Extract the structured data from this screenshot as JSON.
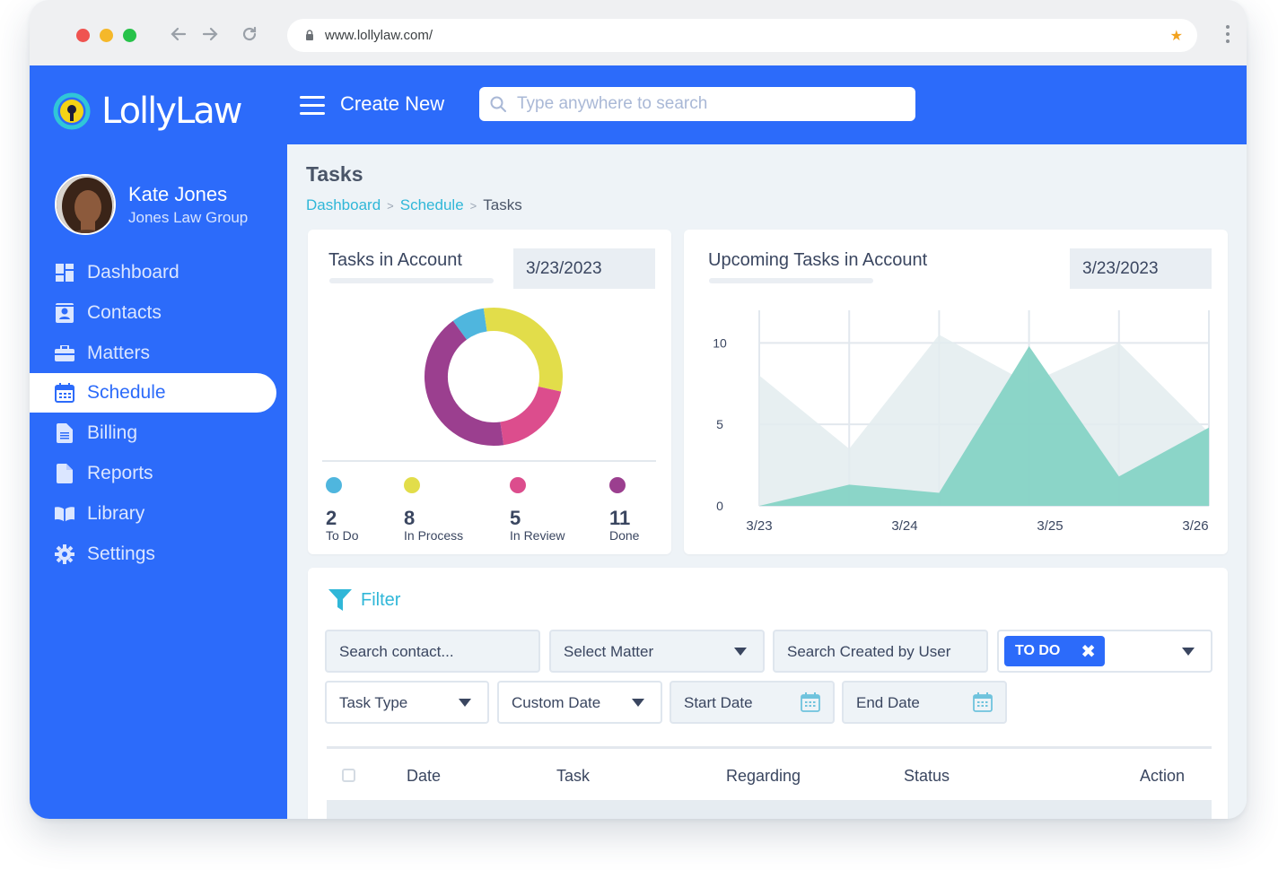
{
  "browser": {
    "url": "www.lollylaw.com/"
  },
  "brand": {
    "name": "LollyLaw",
    "primary_color": "#2c6bfa",
    "accent_color": "#30b7d8"
  },
  "user": {
    "name": "Kate Jones",
    "organization": "Jones Law Group"
  },
  "sidebar": {
    "items": [
      {
        "label": "Dashboard",
        "icon": "dashboard-icon"
      },
      {
        "label": "Contacts",
        "icon": "contacts-icon"
      },
      {
        "label": "Matters",
        "icon": "briefcase-icon"
      },
      {
        "label": "Schedule",
        "icon": "calendar-icon",
        "active": true
      },
      {
        "label": "Billing",
        "icon": "document-icon"
      },
      {
        "label": "Reports",
        "icon": "file-icon"
      },
      {
        "label": "Library",
        "icon": "book-icon"
      },
      {
        "label": "Settings",
        "icon": "gear-icon"
      }
    ]
  },
  "topbar": {
    "create_new": "Create New",
    "search_placeholder": "Type anywhere to search"
  },
  "page": {
    "title": "Tasks",
    "breadcrumb": [
      "Dashboard",
      "Schedule",
      "Tasks"
    ]
  },
  "tasks_card": {
    "title": "Tasks in Account",
    "date": "3/23/2023",
    "stats": [
      {
        "value": "2",
        "label": "To Do",
        "color": "#4fb6de"
      },
      {
        "value": "8",
        "label": "In Process",
        "color": "#e2dd4a"
      },
      {
        "value": "5",
        "label": "In Review",
        "color": "#dc4d8d"
      },
      {
        "value": "11",
        "label": "Done",
        "color": "#9b3f8f"
      }
    ]
  },
  "upcoming_card": {
    "title": "Upcoming Tasks in Account",
    "date": "3/23/2023"
  },
  "chart_data": [
    {
      "type": "pie",
      "title": "Tasks in Account",
      "donut": true,
      "categories": [
        "To Do",
        "In Process",
        "In Review",
        "Done"
      ],
      "values": [
        2,
        8,
        5,
        11
      ],
      "colors": [
        "#4fb6de",
        "#e2dd4a",
        "#dc4d8d",
        "#9b3f8f"
      ]
    },
    {
      "type": "area",
      "title": "Upcoming Tasks in Account",
      "x_ticks": [
        "3/23",
        "3/24",
        "3/25",
        "3/26"
      ],
      "y_ticks": [
        0,
        5,
        10
      ],
      "ylim": [
        0,
        12
      ],
      "x": [
        0,
        1,
        2,
        3,
        4,
        5
      ],
      "series": [
        {
          "values": [
            8,
            3.5,
            10.5,
            7.5,
            10,
            4.5
          ],
          "color": "#e3ecef"
        },
        {
          "values": [
            0,
            1.3,
            0.8,
            9.8,
            1.8,
            4.8
          ],
          "color": "#86d3c5"
        }
      ],
      "grid": true
    }
  ],
  "filter": {
    "label": "Filter",
    "search_contact": "Search contact...",
    "select_matter": "Select Matter",
    "search_created_by": "Search Created by User",
    "status_chip": "TO DO",
    "task_type": "Task Type",
    "custom_date": "Custom Date",
    "start_date": "Start Date",
    "end_date": "End Date"
  },
  "table": {
    "headers": [
      "Date",
      "Task",
      "Regarding",
      "Status",
      "Action"
    ]
  }
}
